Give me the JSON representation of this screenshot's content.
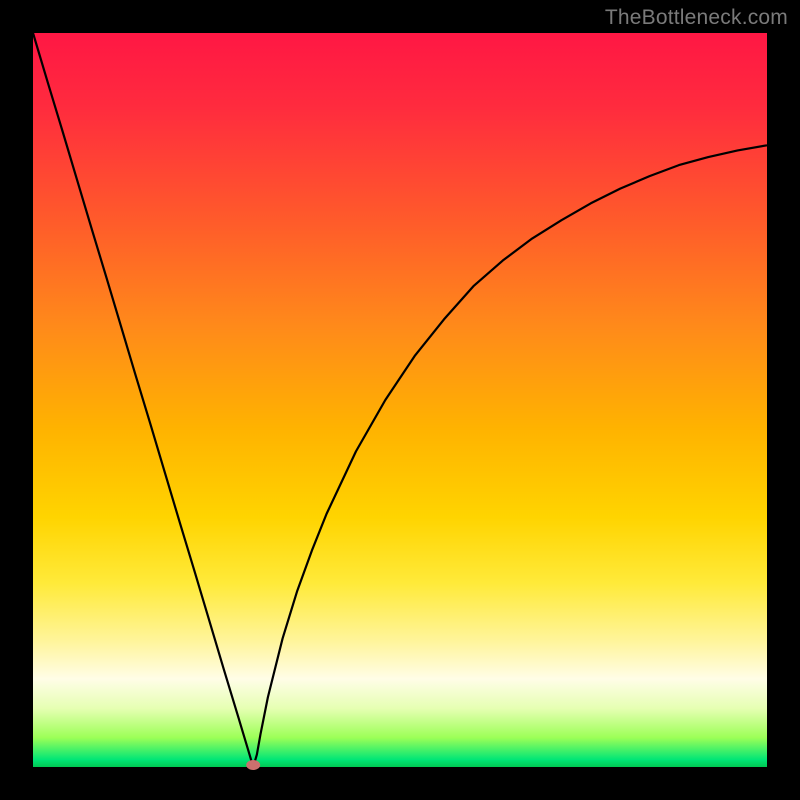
{
  "watermark": "TheBottleneck.com",
  "chart_data": {
    "type": "line",
    "title": "",
    "xlabel": "",
    "ylabel": "",
    "xlim": [
      0,
      100
    ],
    "ylim": [
      0,
      100
    ],
    "grid": false,
    "legend": false,
    "series": [
      {
        "name": "curve",
        "x": [
          0,
          2,
          4,
          6,
          8,
          10,
          12,
          14,
          16,
          18,
          20,
          22,
          24,
          26,
          28,
          29.5,
          30,
          30.5,
          31,
          32,
          34,
          36,
          38,
          40,
          44,
          48,
          52,
          56,
          60,
          64,
          68,
          72,
          76,
          80,
          84,
          88,
          92,
          96,
          100
        ],
        "y": [
          100,
          93.3,
          86.7,
          80,
          73.3,
          66.7,
          60,
          53.3,
          46.7,
          40,
          33.3,
          26.7,
          20,
          13.3,
          6.7,
          1.7,
          0,
          1.7,
          4.5,
          9.5,
          17.5,
          24,
          29.5,
          34.5,
          43,
          50,
          56,
          61,
          65.5,
          69,
          72,
          74.5,
          76.8,
          78.8,
          80.5,
          82,
          83.1,
          84,
          84.7
        ]
      }
    ],
    "marker": {
      "x": 30,
      "y": 0
    },
    "background_gradient_domain": "bottleneck-heatmap"
  }
}
